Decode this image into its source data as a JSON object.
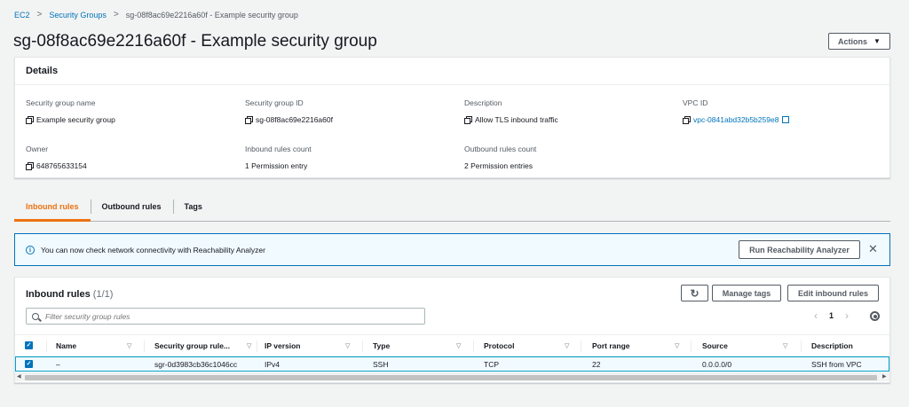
{
  "breadcrumb": {
    "items": [
      "EC2",
      "Security Groups"
    ],
    "current": "sg-08f8ac69e2216a60f - Example security group"
  },
  "page": {
    "title": "sg-08f8ac69e2216a60f - Example security group",
    "actions_label": "Actions"
  },
  "details": {
    "heading": "Details",
    "fields": {
      "sg_name": {
        "label": "Security group name",
        "value": "Example security group"
      },
      "sg_id": {
        "label": "Security group ID",
        "value": "sg-08f8ac69e2216a60f"
      },
      "description": {
        "label": "Description",
        "value": "Allow TLS inbound traffic"
      },
      "vpc_id": {
        "label": "VPC ID",
        "value": "vpc-0841abd32b5b259e8"
      },
      "owner": {
        "label": "Owner",
        "value": "648765633154"
      },
      "inbound_count": {
        "label": "Inbound rules count",
        "value": "1 Permission entry"
      },
      "outbound_count": {
        "label": "Outbound rules count",
        "value": "2 Permission entries"
      }
    }
  },
  "tabs": [
    {
      "label": "Inbound rules",
      "active": true
    },
    {
      "label": "Outbound rules",
      "active": false
    },
    {
      "label": "Tags",
      "active": false
    }
  ],
  "flash": {
    "message": "You can now check network connectivity with Reachability Analyzer",
    "button_label": "Run Reachability Analyzer",
    "dismiss_glyph": "✕",
    "info_glyph": "i"
  },
  "rules": {
    "title": "Inbound rules",
    "count": "(1/1)",
    "refresh_glyph": "↻",
    "manage_tags_label": "Manage tags",
    "edit_label": "Edit inbound rules",
    "search_placeholder": "Filter security group rules",
    "page_number": "1",
    "prev_glyph": "‹",
    "next_glyph": "›",
    "columns": [
      "Name",
      "Security group rule...",
      "IP version",
      "Type",
      "Protocol",
      "Port range",
      "Source",
      "Description"
    ],
    "sort_glyph": "▽",
    "check_glyph": "✓",
    "rows": [
      {
        "name": "–",
        "rule_id": "sgr-0d3983cb36c1046cc",
        "ip_version": "IPv4",
        "type": "SSH",
        "protocol": "TCP",
        "port_range": "22",
        "source": "0.0.0.0/0",
        "description": "SSH from VPC"
      }
    ]
  }
}
